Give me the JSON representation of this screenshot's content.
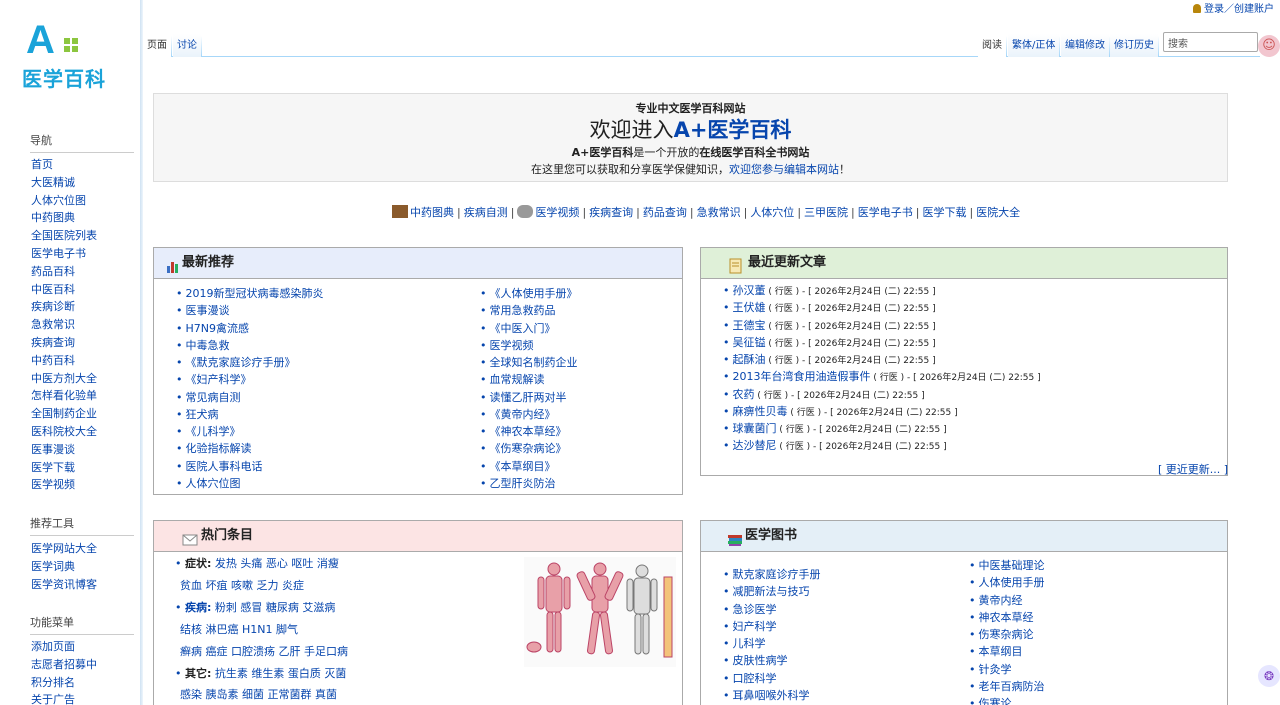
{
  "site": {
    "logo_letter": "A",
    "logo_text": "医学百科"
  },
  "personal": {
    "label": "登录／创建账户"
  },
  "tabs": {
    "page": "页面",
    "talk": "讨论",
    "read": "阅读",
    "variant": "繁体/正体",
    "edit": "编辑修改",
    "history": "修订历史"
  },
  "search": {
    "placeholder": "搜索"
  },
  "sidebar": {
    "nav_title": "导航",
    "nav_items": [
      "首页",
      "大医精诚",
      "人体穴位图",
      "中药图典",
      "全国医院列表",
      "医学电子书",
      "药品百科",
      "中医百科",
      "疾病诊断",
      "急救常识",
      "疾病查询",
      "中药百科",
      "中医方剂大全",
      "怎样看化验单",
      "全国制药企业",
      "医科院校大全",
      "医事漫谈",
      "医学下载",
      "医学视频"
    ],
    "tools_title": "推荐工具",
    "tools_items": [
      "医学网站大全",
      "医学词典",
      "医学资讯博客"
    ],
    "func_title": "功能菜单",
    "func_items": [
      "添加页面",
      "志愿者招募中",
      "积分排名",
      "关于广告"
    ]
  },
  "welcome": {
    "line1": "专业中文医学百科网站",
    "line2_pre": "欢迎进入",
    "line2_bold": "A+医学百科",
    "line3_bold1": "A+医学百科",
    "line3_mid": "是一个开放的",
    "line3_bold2": "在线医学百科全书网站",
    "line4_pre": "在这里您可以获取和分享医学保健知识，",
    "line4_link": "欢迎您参与编辑本网站",
    "line4_post": "！"
  },
  "quick_links": [
    "中药图典",
    "疾病自测",
    "医学视频",
    "疾病查询",
    "药品查询",
    "急救常识",
    "人体穴位",
    "三甲医院",
    "医学电子书",
    "医学下载",
    "医院大全"
  ],
  "latest": {
    "title": "最新推荐",
    "col1": [
      "2019新型冠状病毒感染肺炎",
      "医事漫谈",
      "H7N9禽流感",
      "中毒急救",
      "《默克家庭诊疗手册》",
      "《妇产科学》",
      "常见病自测",
      "狂犬病",
      "《儿科学》",
      "化验指标解读",
      "医院人事科电话",
      "人体穴位图"
    ],
    "col2": [
      "《人体使用手册》",
      "常用急救药品",
      "《中医入门》",
      "医学视频",
      "全球知名制药企业",
      "血常规解读",
      "读懂乙肝两对半",
      "《黄帝内经》",
      "《神农本草经》",
      "《伤寒杂病论》",
      "《本草纲目》",
      "乙型肝炎防治"
    ]
  },
  "recent": {
    "title": "最近更新文章",
    "user": "行医",
    "time": "2026年2月24日 (二) 22:55",
    "items": [
      "孙汉董",
      "王伏雄",
      "王德宝",
      "吴征镒",
      "起酥油",
      "2013年台湾食用油造假事件",
      "农药",
      "麻痹性贝毒",
      "球囊菌门",
      "达沙替尼"
    ],
    "more": "[ 更近更新... ]"
  },
  "hot": {
    "title": "热门条目",
    "sym_label": "症状:",
    "sym1": "发热 头痛 恶心 呕吐 消瘦",
    "sym2": "贫血 坏疽 咳嗽 乏力 炎症",
    "dis_label": "疾病:",
    "dis1": "粉刺 感冒 糖尿病 艾滋病",
    "dis2": "结核 淋巴癌 H1N1 脚气",
    "dis3": "癣病 癌症 口腔溃疡 乙肝 手足口病",
    "oth_label": "其它:",
    "oth1": "抗生素 维生素 蛋白质 灭菌",
    "oth2": "感染 胰岛素 细菌 正常菌群 真菌"
  },
  "books": {
    "title": "医学图书",
    "col1": [
      "默克家庭诊疗手册",
      "减肥新法与技巧",
      "急诊医学",
      "妇产科学",
      "儿科学",
      "皮肤性病学",
      "口腔科学",
      "耳鼻咽喉外科学"
    ],
    "col2": [
      "中医基础理论",
      "人体使用手册",
      "黄帝内经",
      "神农本草经",
      "伤寒杂病论",
      "本草纲目",
      "针灸学",
      "老年百病防治",
      "伤寒论"
    ]
  },
  "colors": {
    "link": "#0645ad",
    "logo": "#1aa3d9",
    "latest_bg": "#e7edfb",
    "recent_bg": "#dff0d8",
    "hot_bg": "#fce4e4",
    "books_bg": "#e4eff7"
  }
}
